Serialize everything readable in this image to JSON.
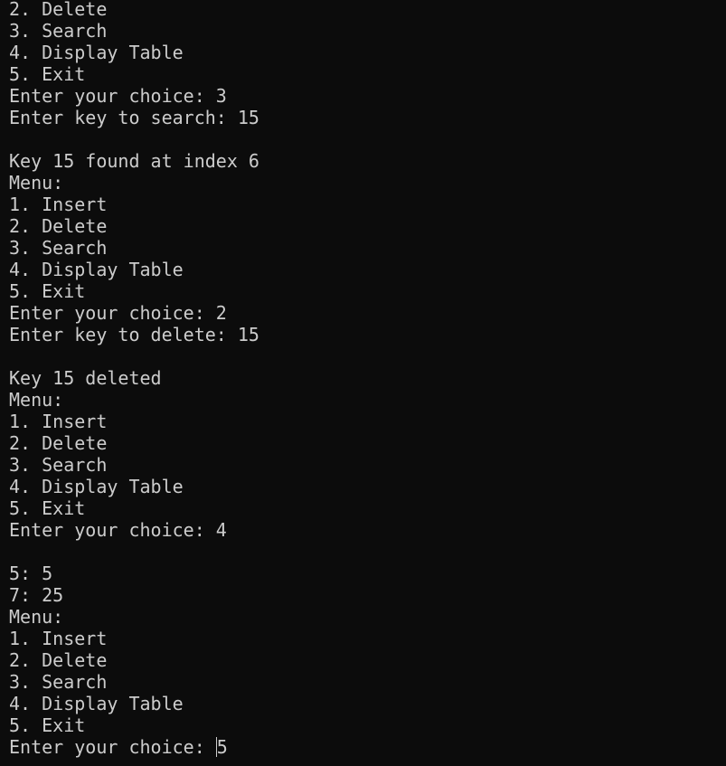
{
  "terminal": {
    "lines": [
      "2. Delete",
      "3. Search",
      "4. Display Table",
      "5. Exit",
      "Enter your choice: 3",
      "Enter key to search: 15",
      "",
      "Key 15 found at index 6",
      "Menu:",
      "1. Insert",
      "2. Delete",
      "3. Search",
      "4. Display Table",
      "5. Exit",
      "Enter your choice: 2",
      "Enter key to delete: 15",
      "",
      "Key 15 deleted",
      "Menu:",
      "1. Insert",
      "2. Delete",
      "3. Search",
      "4. Display Table",
      "5. Exit",
      "Enter your choice: 4",
      "",
      "5: 5",
      "7: 25",
      "Menu:",
      "1. Insert",
      "2. Delete",
      "3. Search",
      "4. Display Table",
      "5. Exit"
    ],
    "prompt": "Enter your choice: ",
    "input_value": "5"
  }
}
